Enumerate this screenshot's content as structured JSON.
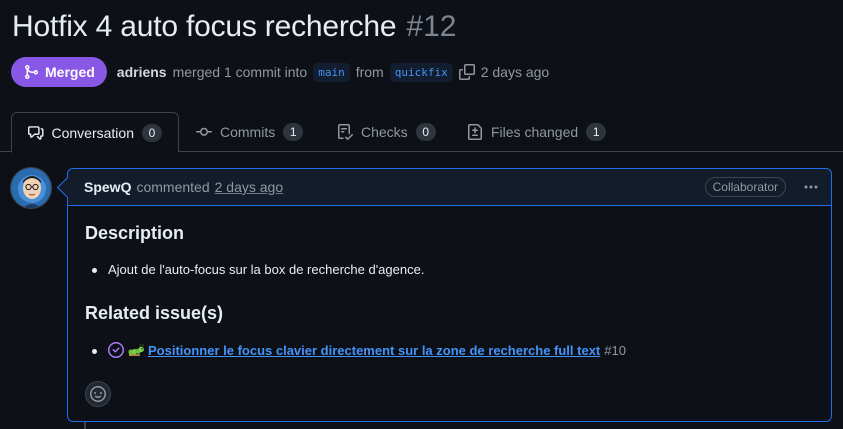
{
  "header": {
    "title": "Hotfix 4 auto focus recherche",
    "number": "#12"
  },
  "meta": {
    "state": "Merged",
    "author": "adriens",
    "text_merged": "merged 1 commit into",
    "base_branch": "main",
    "text_from": "from",
    "head_branch": "quickfix",
    "time": "2 days ago"
  },
  "tabs": [
    {
      "label": "Conversation",
      "count": "0",
      "icon": "comment-discussion-icon"
    },
    {
      "label": "Commits",
      "count": "1",
      "icon": "git-commit-icon"
    },
    {
      "label": "Checks",
      "count": "0",
      "icon": "checklist-icon"
    },
    {
      "label": "Files changed",
      "count": "1",
      "icon": "file-diff-icon"
    }
  ],
  "comment": {
    "author": "SpewQ",
    "action": "commented",
    "time": "2 days ago",
    "role": "Collaborator",
    "description_heading": "Description",
    "bullets": [
      "Ajout de l'auto-focus sur la box de recherche d'agence."
    ],
    "related_heading": "Related issue(s)",
    "issue": {
      "emoji": "caterpillar",
      "title": "Positionner le focus clavier directement sur la zone de recherche full text",
      "number": "#10"
    }
  },
  "colors": {
    "background": "#0d1117",
    "merged": "#8957e5",
    "link": "#4493f8",
    "comment_border": "#1f6feb"
  }
}
